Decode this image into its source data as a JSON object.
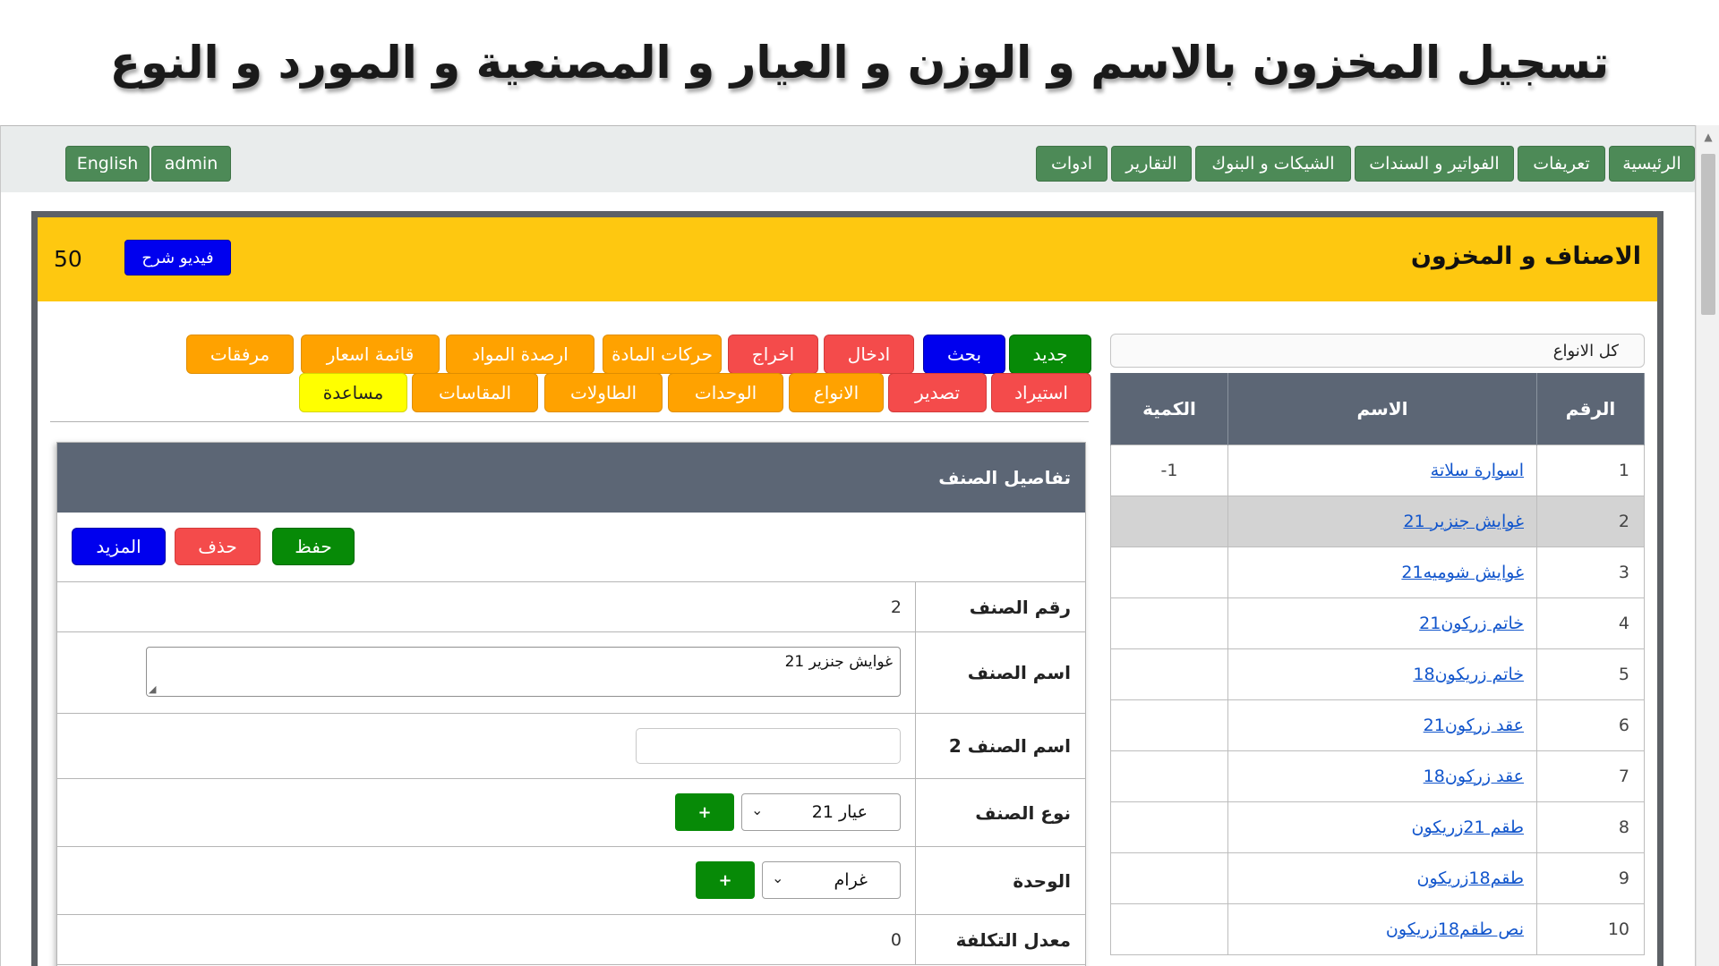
{
  "headline": "تسجيل المخزون بالاسم و الوزن و العيار و المصنعية و المورد و النوع",
  "nav": {
    "menu": [
      "الرئيسية",
      "تعريفات",
      "الفواتير و السندات",
      "الشيكات و البنوك",
      "التقارير",
      "ادوات"
    ],
    "user": "admin",
    "language": "English"
  },
  "section": {
    "title": "الاصناف و المخزون",
    "video_label": "فيديو شرح",
    "count": "50"
  },
  "filter": {
    "type_value": "كل الانواع"
  },
  "table": {
    "headers": {
      "num": "الرقم",
      "name": "الاسم",
      "qty": "الكمية"
    },
    "rows": [
      {
        "num": "1",
        "name": "اسوارة سلاتة",
        "qty": "-1"
      },
      {
        "num": "2",
        "name": "غوايش جنزير 21",
        "qty": ""
      },
      {
        "num": "3",
        "name": "غوايش شوميه21",
        "qty": ""
      },
      {
        "num": "4",
        "name": "خاتم زركون21",
        "qty": ""
      },
      {
        "num": "5",
        "name": "خاتم زريكون18",
        "qty": ""
      },
      {
        "num": "6",
        "name": "عقد زركون21",
        "qty": ""
      },
      {
        "num": "7",
        "name": "عقد زركون18",
        "qty": ""
      },
      {
        "num": "8",
        "name": "طقم 21زريكون",
        "qty": ""
      },
      {
        "num": "9",
        "name": "طقم18زريكون",
        "qty": ""
      },
      {
        "num": "10",
        "name": "نص طقم18زريكون",
        "qty": ""
      }
    ],
    "selected_num": "2"
  },
  "actions": {
    "row1": {
      "new": "جديد",
      "search": "بحث",
      "entry": "ادخال",
      "exit": "اخراج",
      "movements": "حركات المادة",
      "balances": "ارصدة المواد",
      "price_list": "قائمة اسعار",
      "attachments": "مرفقات"
    },
    "row2": {
      "import": "استيراد",
      "export": "تصدير",
      "types": "الانواع",
      "units": "الوحدات",
      "tables": "الطاولات",
      "sizes": "المقاسات",
      "help": "مساعدة"
    }
  },
  "details": {
    "title": "تفاصيل الصنف",
    "save": "حفظ",
    "delete": "حذف",
    "more": "المزيد",
    "fields": {
      "item_no_label": "رقم الصنف",
      "item_no_value": "2",
      "item_name_label": "اسم الصنف",
      "item_name_value": "غوايش جنزير 21",
      "item_name2_label": "اسم الصنف 2",
      "item_name2_value": "",
      "item_type_label": "نوع الصنف",
      "item_type_value": "عيار 21",
      "unit_label": "الوحدة",
      "unit_value": "غرام",
      "cost_label": "معدل التكلفة",
      "cost_value": "0"
    },
    "add_symbol": "+"
  },
  "colors": {
    "nav_green": "#4d8a57",
    "header_yellow": "#fec810",
    "table_header": "#5c6675",
    "button_green": "#078a07",
    "button_blue": "#0000ee",
    "button_red": "#f44b4b",
    "button_orange": "#ffa200",
    "button_yellow": "#ffff00",
    "link_blue": "#1155cc"
  },
  "icons": {
    "dropdown": "chevron-down-icon",
    "resize": "resize-grip-icon",
    "scroll_up": "arrow-up-icon"
  }
}
